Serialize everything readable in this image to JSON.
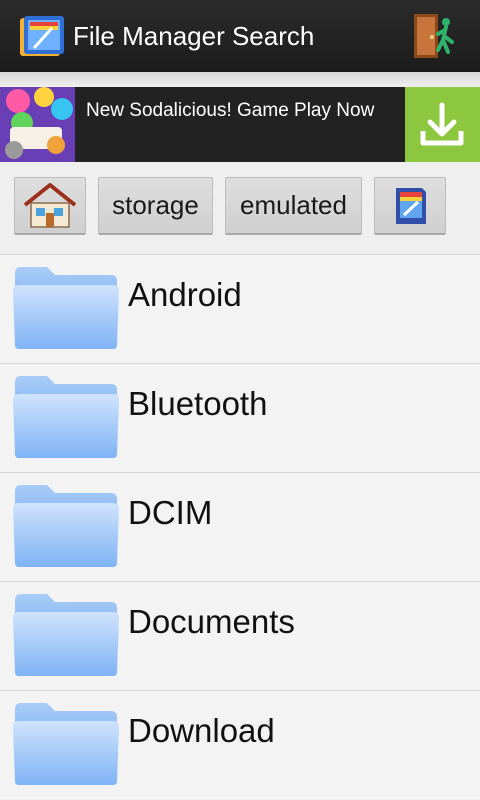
{
  "app": {
    "title": "File Manager Search"
  },
  "ad": {
    "text": "New Sodalicious! Game Play Now"
  },
  "breadcrumb": {
    "items": [
      {
        "label": "",
        "icon": "home-icon"
      },
      {
        "label": "storage"
      },
      {
        "label": "emulated"
      },
      {
        "label": "",
        "icon": "sdcard-icon"
      }
    ]
  },
  "files": [
    {
      "name": "Android",
      "type": "folder"
    },
    {
      "name": "Bluetooth",
      "type": "folder"
    },
    {
      "name": "DCIM",
      "type": "folder"
    },
    {
      "name": "Documents",
      "type": "folder"
    },
    {
      "name": "Download",
      "type": "folder"
    }
  ],
  "colors": {
    "actionbar": "#222222",
    "ad_accent": "#8dc63f",
    "folder": "#7fb3f5"
  }
}
